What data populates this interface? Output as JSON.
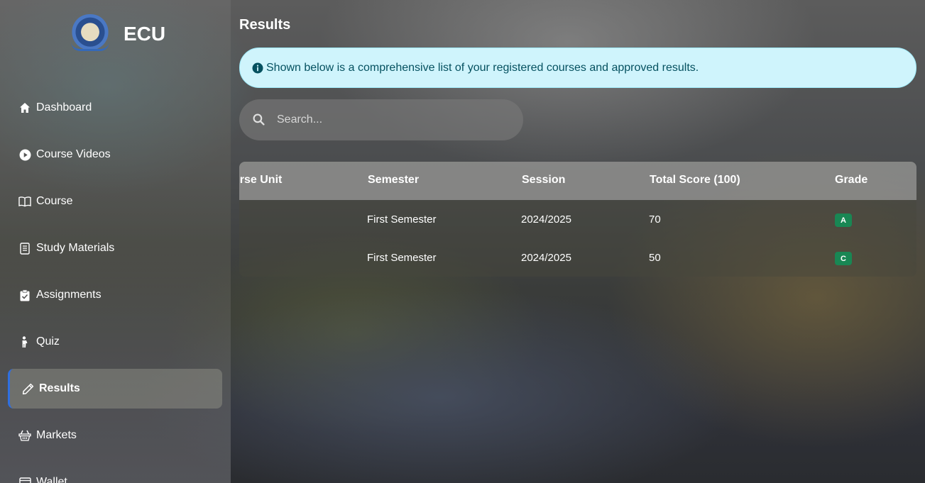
{
  "brand": {
    "name": "ECU"
  },
  "sidebar": {
    "items": [
      {
        "label": "Dashboard",
        "icon": "home-icon"
      },
      {
        "label": "Course Videos",
        "icon": "play-circle-icon"
      },
      {
        "label": "Course",
        "icon": "book-open-icon"
      },
      {
        "label": "Study Materials",
        "icon": "document-list-icon"
      },
      {
        "label": "Assignments",
        "icon": "clipboard-check-icon"
      },
      {
        "label": "Quiz",
        "icon": "person-icon"
      },
      {
        "label": "Results",
        "icon": "pencil-icon",
        "active": true
      },
      {
        "label": "Markets",
        "icon": "basket-icon"
      },
      {
        "label": "Wallet",
        "icon": "wallet-icon"
      }
    ]
  },
  "main": {
    "title": "Results",
    "alert": "Shown below is a comprehensive list of your registered courses and approved results.",
    "search": {
      "placeholder": "Search..."
    },
    "table": {
      "headers": [
        "urse Unit",
        "Semester",
        "Session",
        "Total Score (100)",
        "Grade"
      ],
      "rows": [
        {
          "semester": "First Semester",
          "session": "2024/2025",
          "score": "70",
          "grade": "A"
        },
        {
          "semester": "First Semester",
          "session": "2024/2025",
          "score": "50",
          "grade": "C"
        }
      ]
    }
  },
  "colors": {
    "accent": "#2f6fe0",
    "alert_bg": "#cff4fc",
    "alert_text": "#055160",
    "grade_badge": "#198754"
  }
}
